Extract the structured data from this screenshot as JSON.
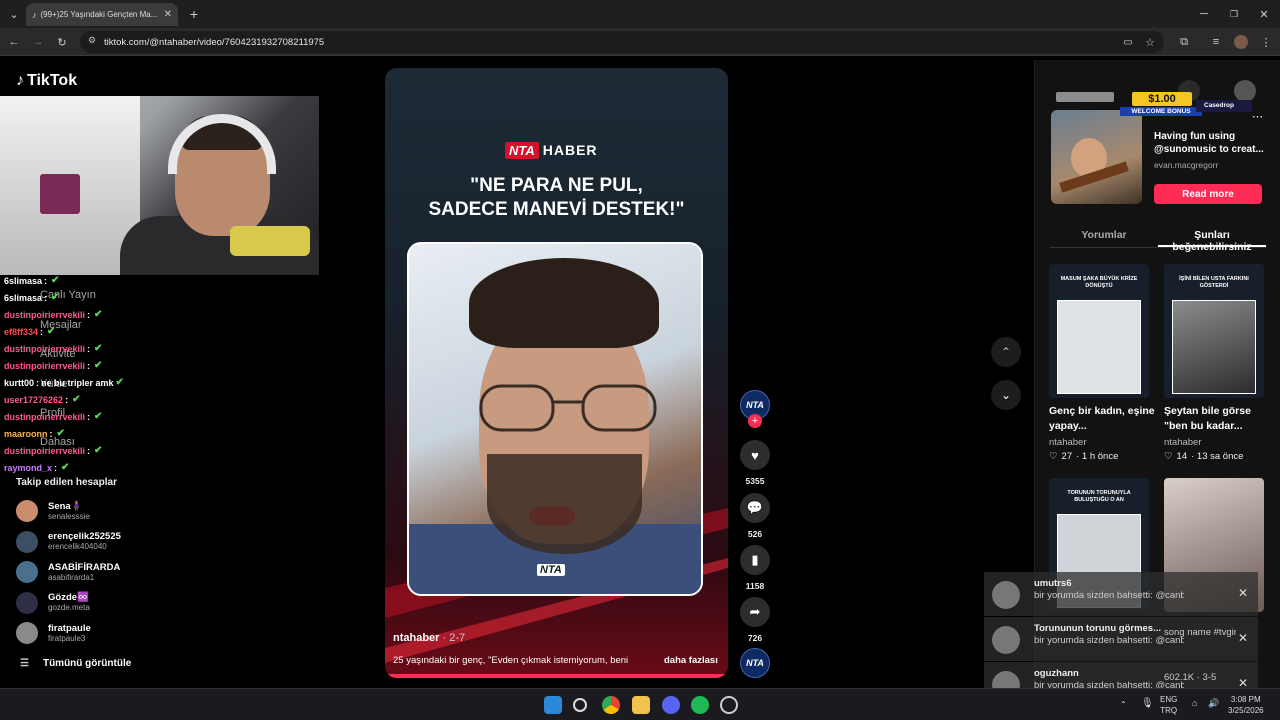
{
  "browser": {
    "tab_title": "(99+)25 Yaşındaki Gençten Ma...",
    "url": "tiktok.com/@ntahaber/video/7604231932708211975"
  },
  "sidebar": {
    "logo": "TikTok",
    "nav_ghost": [
      "Canlı Yayın",
      "Mesajlar",
      "Aktivite",
      "Yükle",
      "Profil",
      "Dahası"
    ],
    "chat": [
      {
        "user": "6slimasa",
        "msg": "",
        "color": "#ffffff"
      },
      {
        "user": "6slimasa",
        "msg": "",
        "color": "#ffffff"
      },
      {
        "user": "dustinpoirierrvekili",
        "msg": "",
        "color": "#ff5a8c"
      },
      {
        "user": "ef8ff334",
        "msg": "",
        "color": "#ff4d4d"
      },
      {
        "user": "dustinpoirierrvekili",
        "msg": "",
        "color": "#ff5a8c"
      },
      {
        "user": "dustinpoirierrvekili",
        "msg": "",
        "color": "#ff5a8c"
      },
      {
        "user": "kurtt00",
        "msg": "ne bu tripler amk",
        "color": "#ffffff"
      },
      {
        "user": "user17276262",
        "msg": "",
        "color": "#ff5a8c"
      },
      {
        "user": "dustinpoirierrvekili",
        "msg": "",
        "color": "#ff5a8c"
      },
      {
        "user": "maaroonn",
        "msg": "",
        "color": "#ffb347"
      },
      {
        "user": "dustinpoirierrvekili",
        "msg": "",
        "color": "#ff5a8c"
      },
      {
        "user": "raymond_x",
        "msg": "",
        "color": "#c77dff"
      }
    ],
    "followed_title": "Takip edilen hesaplar",
    "followed": [
      {
        "name": "Sena🧍🏽‍♀️",
        "handle": "senalesssie"
      },
      {
        "name": "erençelik252525",
        "handle": "erencelik404040"
      },
      {
        "name": "ASABİFİRARDA",
        "handle": "asabifirarda1"
      },
      {
        "name": "Gözde♾️",
        "handle": "gozde.meta"
      },
      {
        "name": "firatpaule",
        "handle": "firatpaule3"
      }
    ],
    "see_all": "Tümünü görüntüle"
  },
  "video": {
    "brand_box": "NTA",
    "brand_text": "HABER",
    "quote_line1": "\"NE PARA NE PUL,",
    "quote_line2": "SADECE MANEVİ DESTEK!\"",
    "watermark": "NTA",
    "author": "ntahaber",
    "date": "· 2-7",
    "description": "25 yaşındaki bir genç, \"Evden çıkmak istemiyorum, beni",
    "more": "daha fazlası"
  },
  "actions": {
    "avatar": "NTA",
    "likes": "5355",
    "comments": "526",
    "saves": "1158",
    "shares": "726"
  },
  "ad": {
    "banner_amount": "$1.00",
    "banner_sub": "WELCOME BONUS",
    "banner_brand": "Casedrop",
    "title": "Having fun using @sunomusic to creat...",
    "user": "evan.macgregorr",
    "button": "Read more"
  },
  "tabs": {
    "comments": "Yorumlar",
    "suggested": "Şunları beğenebilirsiniz"
  },
  "cards": [
    {
      "thumb_title": "MASUM ŞAKA BÜYÜK KRİZE DÖNÜŞTÜ",
      "title": "Genç bir kadın, eşine yapay...",
      "user": "ntahaber",
      "likes": "27",
      "time": "· 1 h önce"
    },
    {
      "thumb_title": "İŞİNİ BİLEN USTA FARKINI GÖSTERDİ",
      "title": "Şeytan bile görse \"ben bu kadar...",
      "user": "ntahaber",
      "likes": "14",
      "time": "· 13 sa önce"
    },
    {
      "thumb_title": "TORUNUN TORUNUYLA BULUŞTUĞU O AN",
      "title": "",
      "user": "",
      "likes": "",
      "time": ""
    },
    {
      "thumb_title": "",
      "title": "",
      "user": "",
      "likes": "",
      "time": ""
    }
  ],
  "notifications": [
    {
      "name": "umutrs6",
      "text": "bir yorumda sizden bahsetti: @canbequit",
      "extra": ""
    },
    {
      "name": "Torununun torunu görmes...",
      "text": "bir yorumda sizden bahsetti: @canbequit chnccj",
      "extra": "song name #tvgirl #repost..."
    },
    {
      "name": "oguzhann",
      "text": "bir yorumda sizden bahsetti: @canbequit ybcld",
      "extra": "602.1K · 3-5"
    }
  ],
  "taskbar": {
    "lang1": "ENG",
    "lang2": "TRQ",
    "time": "3:08 PM",
    "date": "3/25/2026"
  }
}
